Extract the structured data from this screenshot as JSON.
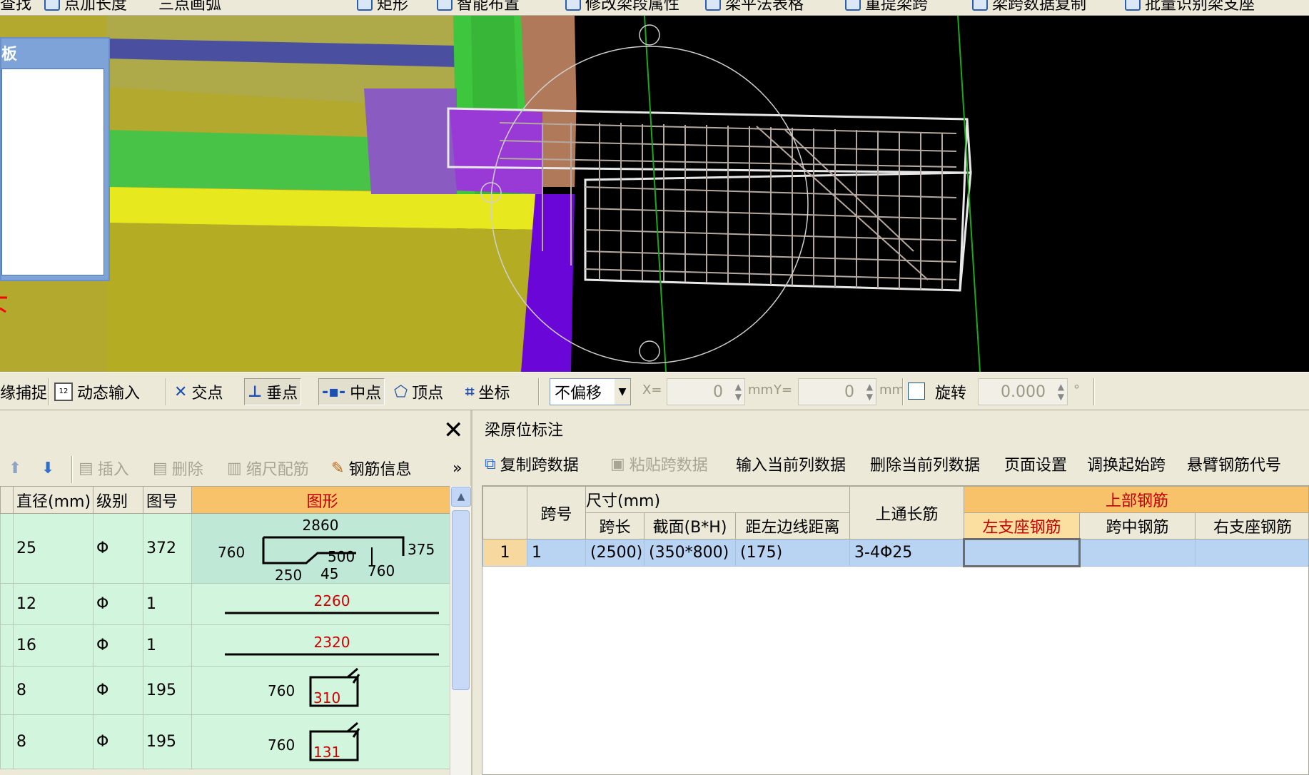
{
  "top_toolbar": {
    "items": [
      "查找",
      "点加长度",
      "三点画弧",
      "矩形",
      "智能布置",
      "修改梁段属性",
      "梁平法表格",
      "重提梁跨",
      "梁跨数据复制",
      "批量识别梁支座"
    ]
  },
  "float_panel": {
    "title": "板"
  },
  "snap_bar": {
    "items": [
      {
        "label": "缘捕捉",
        "icon": "edge-snap-icon"
      },
      {
        "label": "动态输入",
        "icon": "dynamic-input-icon"
      },
      {
        "label": "交点",
        "icon": "intersection-icon"
      },
      {
        "label": "垂点",
        "icon": "perpendicular-icon"
      },
      {
        "label": "中点",
        "icon": "midpoint-icon"
      },
      {
        "label": "顶点",
        "icon": "vertex-icon"
      },
      {
        "label": "坐标",
        "icon": "coordinate-icon"
      }
    ],
    "offset_select": "不偏移",
    "x_label": "X=",
    "x_value": "0",
    "x_unit": "mm",
    "y_label": "Y=",
    "y_value": "0",
    "y_unit": "mm",
    "rotate_label": "旋转",
    "rotate_value": "0.000",
    "rotate_unit": "°"
  },
  "rebar_panel": {
    "close_label": "✕",
    "tools": {
      "insert": "插入",
      "delete": "删除",
      "scale_rebar": "缩尺配筋",
      "rebar_info": "钢筋信息",
      "more": "»"
    },
    "columns": [
      "直径(mm)",
      "级别",
      "图号",
      "图形"
    ],
    "rows": [
      {
        "diameter": "25",
        "grade": "Φ",
        "fig_no": "372",
        "shape": {
          "top": "2860",
          "left": "760",
          "right": "375",
          "mid": "500",
          "b1": "250",
          "b2": "45",
          "b3": "760"
        }
      },
      {
        "diameter": "12",
        "grade": "Φ",
        "fig_no": "1",
        "shape": {
          "len": "2260"
        }
      },
      {
        "diameter": "16",
        "grade": "Φ",
        "fig_no": "1",
        "shape": {
          "len": "2320"
        }
      },
      {
        "diameter": "8",
        "grade": "Φ",
        "fig_no": "195",
        "shape": {
          "left": "760",
          "val": "310"
        }
      },
      {
        "diameter": "8",
        "grade": "Φ",
        "fig_no": "195",
        "shape": {
          "left": "760",
          "val": "131"
        }
      }
    ]
  },
  "beam_panel": {
    "title": "梁原位标注",
    "tools": {
      "copy_span": "复制跨数据",
      "paste_span": "粘贴跨数据",
      "input_col": "输入当前列数据",
      "delete_col": "删除当前列数据",
      "page_setup": "页面设置",
      "swap_start": "调换起始跨",
      "cantilever_code": "悬臂钢筋代号"
    },
    "headers": {
      "span_no": "跨号",
      "size_group": "尺寸(mm)",
      "span_len": "跨长",
      "section": "截面(B*H)",
      "dist_left": "距左边线距离",
      "top_through": "上通长筋",
      "top_rebar": "上部钢筋",
      "left_support": "左支座钢筋",
      "mid_span": "跨中钢筋",
      "right_support": "右支座钢筋"
    },
    "rows": [
      {
        "row": "1",
        "span_no": "1",
        "span_len": "(2500)",
        "section": "(350*800)",
        "dist_left": "(175)",
        "top_through": "3-4Φ25",
        "left_support": "",
        "mid_span": "",
        "right_support": ""
      }
    ]
  }
}
